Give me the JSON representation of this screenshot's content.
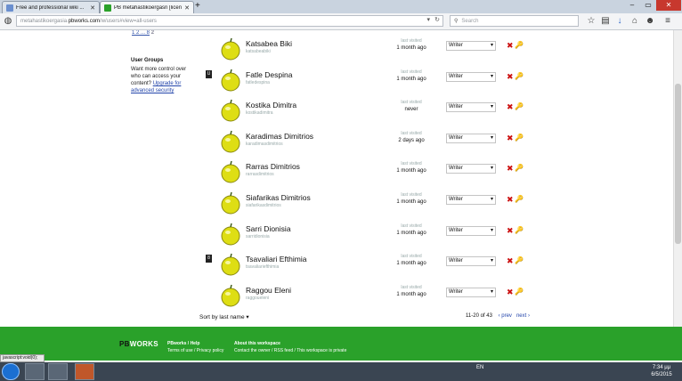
{
  "browser": {
    "tabs": [
      {
        "title": "Free and professional wiki ...",
        "active": false
      },
      {
        "title": "PB metahastikoergasn [licen...",
        "active": true
      }
    ],
    "url_gray": "metahastikoergasia.",
    "url_domain": "pbworks.com",
    "url_path": "/w/users#view=all-users",
    "search_placeholder": "Search"
  },
  "pager_top": {
    "text": "1 2 ... 8",
    "current": "2"
  },
  "user_groups": {
    "title": "User Groups",
    "text": "Want more control over who can access your content? ",
    "link": "Upgrade for advanced security"
  },
  "users": [
    {
      "name": "Katsabea Biki",
      "login": "katsabeabiki",
      "last_label": "last visited",
      "last": "1 month ago",
      "role": "Writer",
      "badge": ""
    },
    {
      "name": "Fatle Despina",
      "login": "fatledespina",
      "last_label": "last visited",
      "last": "1 month ago",
      "role": "Writer",
      "badge": "U"
    },
    {
      "name": "Kostika Dimitra",
      "login": "kostikadimitra",
      "last_label": "last visited",
      "last": "never",
      "role": "Writer",
      "badge": ""
    },
    {
      "name": "Karadimas Dimitrios",
      "login": "karadimasdimitrios",
      "last_label": "last visited",
      "last": "2 days ago",
      "role": "Writer",
      "badge": ""
    },
    {
      "name": "Rarras Dimitrios",
      "login": "rarrasdimitrios",
      "last_label": "last visited",
      "last": "1 month ago",
      "role": "Writer",
      "badge": ""
    },
    {
      "name": "Siafarikas Dimitrios",
      "login": "siafarikasdimitrios",
      "last_label": "last visited",
      "last": "1 month ago",
      "role": "Writer",
      "badge": ""
    },
    {
      "name": "Sarri Dionisia",
      "login": "sarridionisia",
      "last_label": "last visited",
      "last": "1 month ago",
      "role": "Writer",
      "badge": ""
    },
    {
      "name": "Tsavaliari Efthimia",
      "login": "tsavaliariefthimia",
      "last_label": "last visited",
      "last": "1 month ago",
      "role": "Writer",
      "badge": "8"
    },
    {
      "name": "Raggou Eleni",
      "login": "raggoueleni",
      "last_label": "last visited",
      "last": "1 month ago",
      "role": "Writer",
      "badge": ""
    }
  ],
  "sort": {
    "label": "Sort by last name"
  },
  "pager_bottom": {
    "range": "11-20 of 43",
    "prev": "‹ prev",
    "next": "next ›"
  },
  "footer": {
    "logo_a": "PB",
    "logo_b": "WORKS",
    "col1": {
      "h": "PBworks / Help",
      "t": "Terms of use / Privacy policy"
    },
    "col2": {
      "h": "About this workspace",
      "t": "Contact the owner / RSS feed / This workspace is private"
    }
  },
  "status_text": "javascript:void(0);",
  "taskbar": {
    "lang": "EN",
    "time": "7:34 μμ",
    "date": "6/5/2015"
  },
  "colors": {
    "footer_green": "#2aa12a",
    "delete_red": "#cc1111",
    "key_yellow": "#d8a500"
  }
}
